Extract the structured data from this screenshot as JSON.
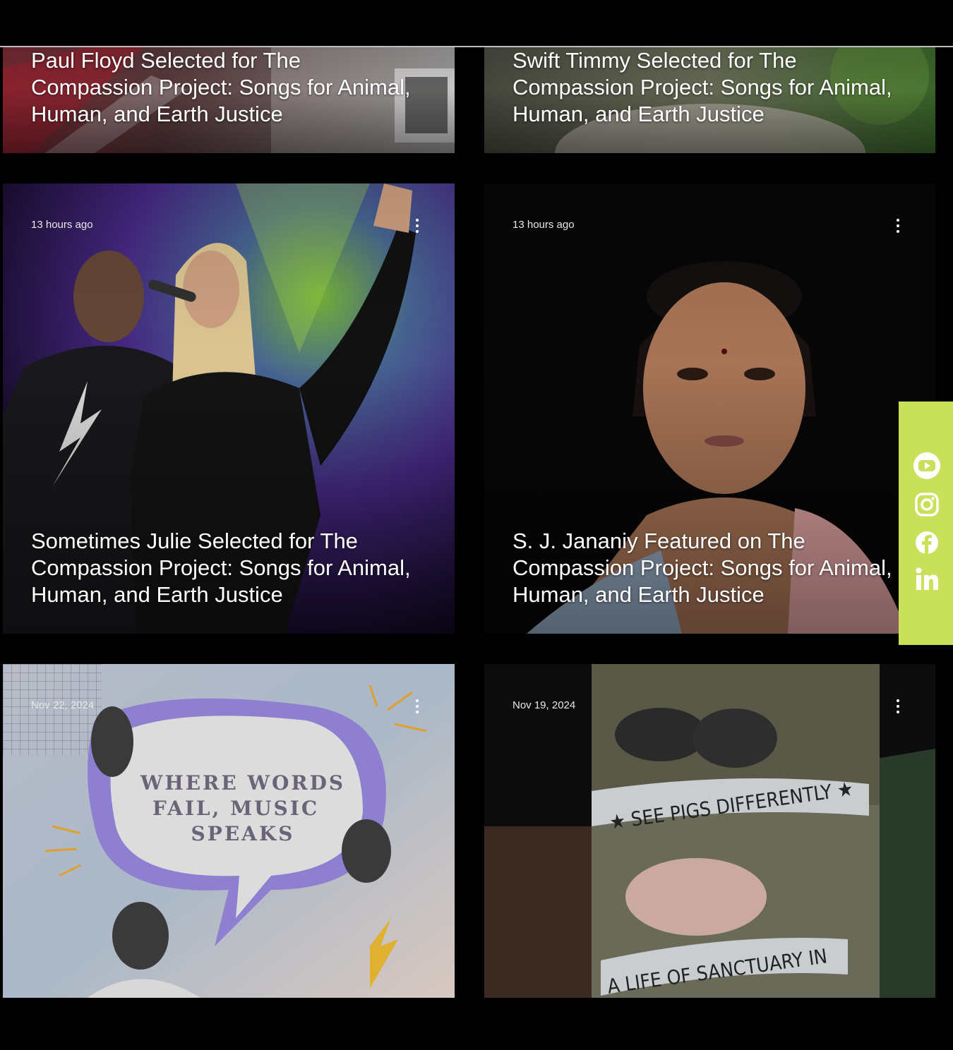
{
  "colors": {
    "background": "#000000",
    "social_bar": "#c8e05a",
    "speech_bubble_outline": "#8e7fd0"
  },
  "cards": [
    {
      "id": "paul-floyd",
      "date": "",
      "title": "Paul Floyd Selected for The Compassion Project: Songs for Animal, Human, and Earth Justice"
    },
    {
      "id": "swift-timmy",
      "date": "",
      "title": "Swift Timmy Selected for The Compassion Project: Songs for Animal, Human, and Earth Justice"
    },
    {
      "id": "sometimes-julie",
      "date": "13 hours ago",
      "title": "Sometimes Julie Selected for The Compassion Project: Songs for Animal, Human, and Earth Justice"
    },
    {
      "id": "sj-jananiy",
      "date": "13 hours ago",
      "title": "S. J. Jananiy Featured on The Compassion Project: Songs for Animal, Human, and Earth Justice"
    },
    {
      "id": "where-words-fail",
      "date": "Nov 22, 2024",
      "title": "",
      "artwork_text": [
        "WHERE WORDS",
        "FAIL, MUSIC",
        "SPEAKS"
      ]
    },
    {
      "id": "see-pigs-differently",
      "date": "Nov 19, 2024",
      "title": "",
      "artwork_text": [
        "★ SEE PIGS DIFFERENTLY ★",
        "A LIFE OF SANCTUARY IN"
      ]
    }
  ],
  "social": {
    "items": [
      {
        "icon": "youtube-icon"
      },
      {
        "icon": "instagram-icon"
      },
      {
        "icon": "facebook-icon"
      },
      {
        "icon": "linkedin-icon"
      }
    ]
  }
}
